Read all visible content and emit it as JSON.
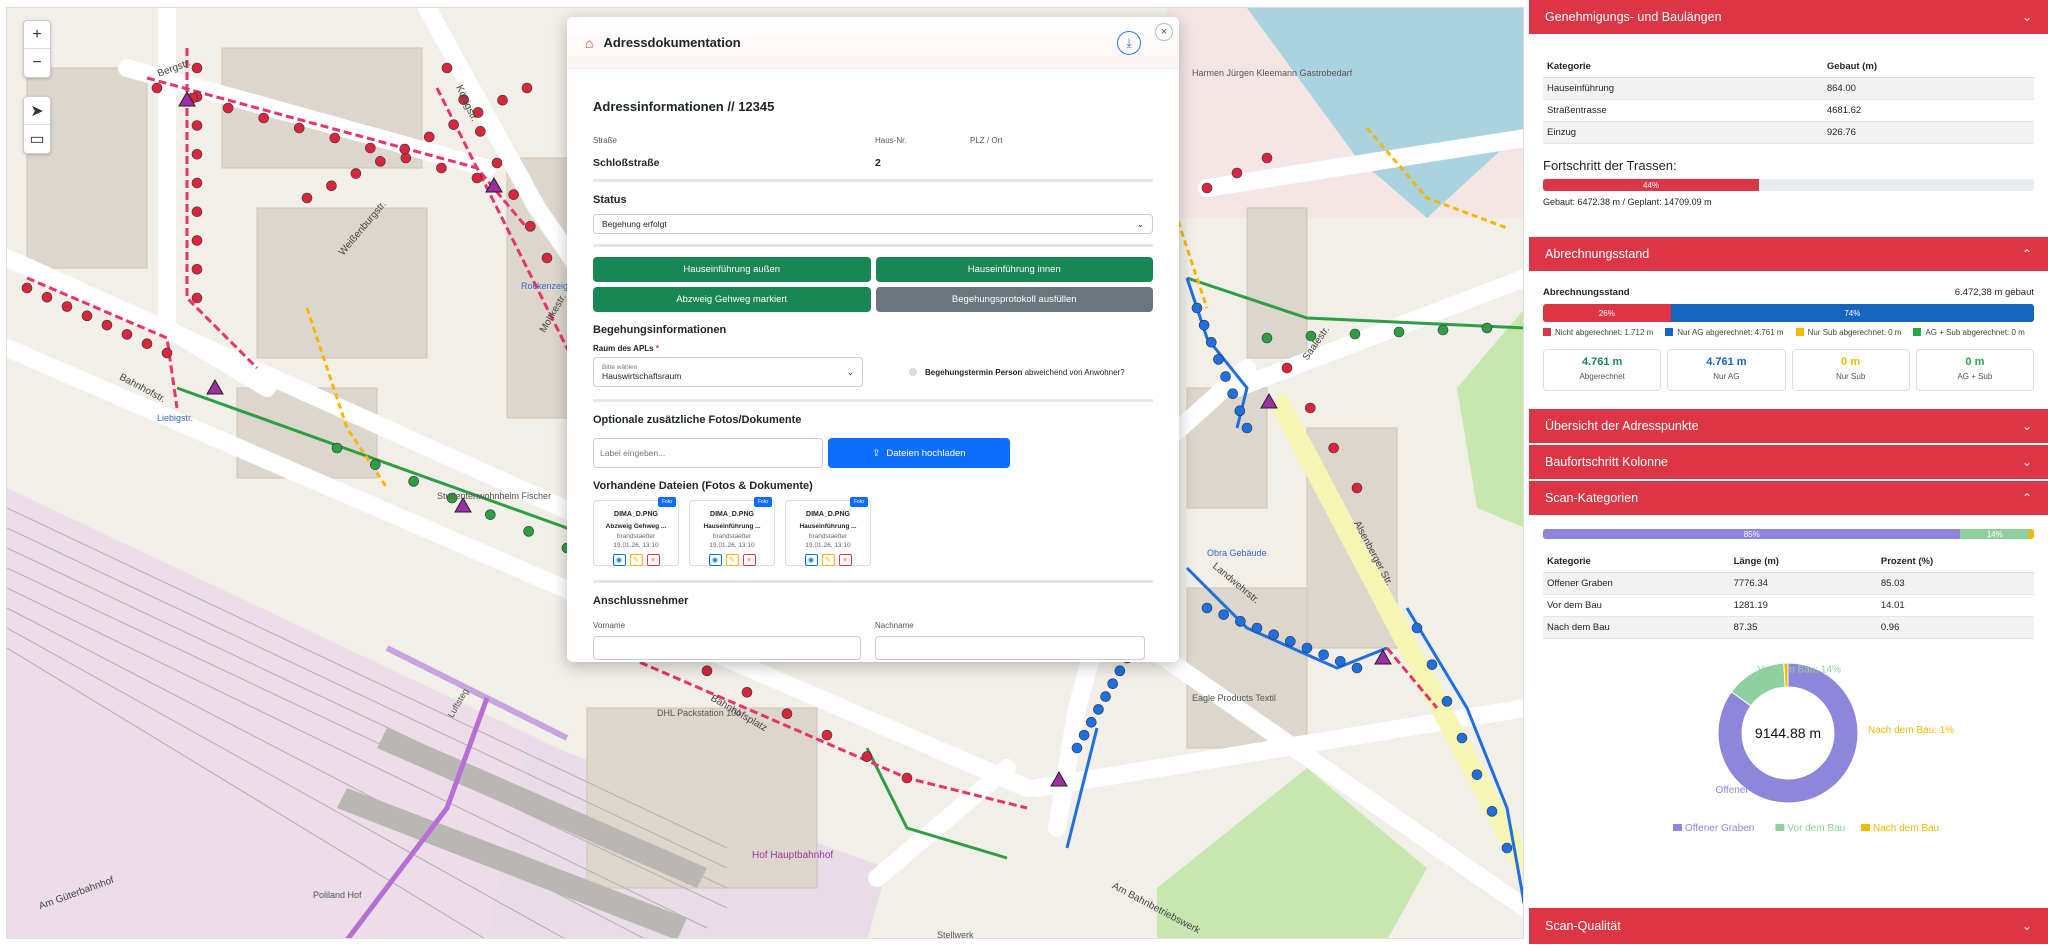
{
  "map": {
    "zoom_in": "+",
    "zoom_out": "−",
    "labels": [
      "Bergstr.",
      "Königstr.",
      "Weißenburgstr.",
      "Moltkestr.",
      "Bahnhofstr.",
      "Landwehrstr.",
      "Saalestr.",
      "Alsenberger Str.",
      "Am Güterbahnhof",
      "Am Bahnbetriebswerk",
      "Bahnhofsplatz",
      "Hof Hauptbahnhof",
      "DHL Packstation 104",
      "Eagle Products Textil",
      "Stellwerk",
      "Luftsteg",
      "Liebigstr.",
      "Poliland Hof",
      "Rockenzeigle",
      "Studentenwohnheim Fischer",
      "Harmen Jürgen Kleemann Gastrobedarf",
      "Obra Gebäude"
    ]
  },
  "modal": {
    "title": "Adressdokumentation",
    "heading": "Adressinformationen // 12345",
    "labels": {
      "street": "Straße",
      "house": "Haus-Nr.",
      "zip": "PLZ / Ort"
    },
    "values": {
      "street": "Schloßstraße",
      "house": "2",
      "zip": ""
    },
    "status_section": "Status",
    "status_value": "Begehung erfolgt",
    "buttons": [
      "Hauseinführung außen",
      "Hauseinführung innen",
      "Abzweig Gehweg markiert",
      "Begehungsprotokoll ausfüllen"
    ],
    "begehung_section": "Begehungsinformationen",
    "raum_label": "Raum des APLs",
    "raum_required": "*",
    "raum_hint": "Bitte wählen",
    "raum_value": "Hauswirtschaftsraum",
    "toggle_bold": "Begehungstermin Person",
    "toggle_rest": "abweichend von Anwohner?",
    "fotos_section": "Optionale zusätzliche Fotos/Dokumente",
    "label_placeholder": "Label eingeben...",
    "upload_button": "Dateien hochladen",
    "files_section": "Vorhandene Dateien (Fotos & Dokumente)",
    "files": [
      {
        "tag": "Foto",
        "name": "DIMA_D.PNG",
        "label": "Abzweig Gehweg ...",
        "user": "brandstaetter",
        "date": "19.01.26, 13:10"
      },
      {
        "tag": "Foto",
        "name": "DIMA_D.PNG",
        "label": "Hauseinführung ...",
        "user": "brandstaetter",
        "date": "19.01.26, 13:10"
      },
      {
        "tag": "Foto",
        "name": "DIMA_D.PNG",
        "label": "Hauseinführung ...",
        "user": "brandstaetter",
        "date": "19.01.26, 13:10"
      }
    ],
    "anschluss_section": "Anschlussnehmer",
    "firstname_label": "Vorname",
    "lastname_label": "Nachname"
  },
  "panel": {
    "genehmigung": {
      "title": "Genehmigungs- und Baulängen",
      "headers": [
        "Kategorie",
        "Gebaut (m)"
      ],
      "rows": [
        [
          "Hauseinführung",
          "864.00"
        ],
        [
          "Straßentrasse",
          "4681.62"
        ],
        [
          "Einzug",
          "926.76"
        ]
      ],
      "progress_title": "Fortschritt der Trassen:",
      "progress_value": 44,
      "progress_label": "44%",
      "progress_text": "Gebaut: 6472.38 m / Geplant: 14709.09 m"
    },
    "abrechnung": {
      "title": "Abrechnungsstand",
      "label": "Abrechnungsstand",
      "built": "6.472,38 m gebaut",
      "bar": [
        {
          "value": 26,
          "label": "26%",
          "color": "#dc3545"
        },
        {
          "value": 74,
          "label": "74%",
          "color": "#1565c0"
        }
      ],
      "legend": [
        {
          "text": "Nicht abgerechnet: 1.712 m",
          "color": "#dc3545"
        },
        {
          "text": "Nur AG abgerechnet: 4.761 m",
          "color": "#1565c0"
        },
        {
          "text": "Nur Sub abgerechnet: 0 m",
          "color": "#f5b800"
        },
        {
          "text": "AG + Sub abgerechnet: 0 m",
          "color": "#28a745"
        }
      ],
      "cards": [
        {
          "value": "4.761 m",
          "label": "Abgerechnet",
          "color": "#198754"
        },
        {
          "value": "4.761 m",
          "label": "Nur AG",
          "color": "#1565c0"
        },
        {
          "value": "0 m",
          "label": "Nur Sub",
          "color": "#f5b800"
        },
        {
          "value": "0 m",
          "label": "AG + Sub",
          "color": "#28a745"
        }
      ]
    },
    "uebersicht_title": "Übersicht der Adresspunkte",
    "baufortschritt_title": "Baufortschritt Kolonne",
    "scan": {
      "title": "Scan-Kategorien",
      "bar": [
        {
          "value": 85.03,
          "label": "85%",
          "color": "#8e86dc"
        },
        {
          "value": 14.01,
          "label": "14%",
          "color": "#8fd19e"
        },
        {
          "value": 0.96,
          "label": "",
          "color": "#f5b800"
        }
      ],
      "headers": [
        "Kategorie",
        "Länge (m)",
        "Prozent (%)"
      ],
      "rows": [
        [
          "Offener Graben",
          "7776.34",
          "85.03"
        ],
        [
          "Vor dem Bau",
          "1281.19",
          "14.01"
        ],
        [
          "Nach dem Bau",
          "87.35",
          "0.96"
        ]
      ]
    },
    "scan_quality_title": "Scan-Qualität"
  },
  "chart_data": {
    "type": "pie",
    "title": "",
    "center_label": "9144.88 m",
    "categories": [
      "Offener Graben",
      "Vor dem Bau",
      "Nach dem Bau"
    ],
    "values": [
      7776.34,
      1281.19,
      87.35
    ],
    "slice_labels": [
      "Offener Graben: 85%",
      "Vor dem Bau: 14%",
      "Nach dem Bau: 1%"
    ],
    "colors": [
      "#8e86dc",
      "#8fd19e",
      "#f5b800"
    ],
    "legend_position": "bottom"
  }
}
